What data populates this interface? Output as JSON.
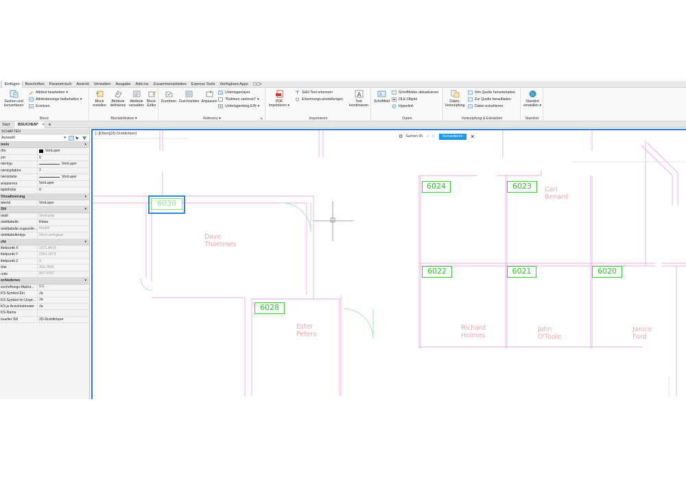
{
  "menu_tabs": [
    "Einfügen",
    "Beschriften",
    "Parametrisch",
    "Ansicht",
    "Verwalten",
    "Ausgabe",
    "Add-ins",
    "Zusammenarbeiten",
    "Express Tools",
    "Verfügbare Apps",
    "▢▢•"
  ],
  "ribbon": {
    "block_panel": {
      "title": "Block",
      "suchen_l1": "Suchen und",
      "suchen_l2": "konvertieren",
      "attr_bearbeiten": "Attribut bearbeiten",
      "attr_beibehalten": "Attributanzeige beibehalten",
      "ersetzen": "Ersetzen"
    },
    "blockdef_panel": {
      "title": "Blockdefinition",
      "block_l1": "Block",
      "block_l2": "erstellen",
      "attr_def_l1": "Attribute",
      "attr_def_l2": "definieren",
      "attr_verw_l1": "Attribute",
      "attr_verw_l2": "verwalten",
      "editor_l1": "Block-",
      "editor_l2": "Editor"
    },
    "referenz_panel": {
      "title": "Referenz",
      "zuordnen": "Zuordnen",
      "zuschneiden": "Zuschneiden",
      "anpassen": "Anpassen",
      "unterlagenlayer": "Unterlagenlayer",
      "rahmen": "*Rahmen variieren*",
      "unterlagenfang": "Unterlagenfang EIN"
    },
    "importieren_panel": {
      "title": "Importieren",
      "pdf_l1": "PDF",
      "pdf_l2": "importieren",
      "shx": "SHX-Text erkennen",
      "erkennung": "Erkennungs-einstellungen",
      "text_l1": "Text",
      "text_l2": "kombinieren"
    },
    "daten_panel": {
      "title": "Daten",
      "schriftfeld": "Schriftfeld",
      "schriftfelder_akt": "Schriftfelder aktualisieren",
      "ole": "OLE-Objekt",
      "hyperlink": "Hyperlink"
    },
    "verkn_panel": {
      "title": "Verknüpfung & Extraktion",
      "datenverkn_l1": "Daten-",
      "datenverkn_l2": "Verknüpfung",
      "herunterladen": "Von Quelle herunterladen",
      "heraufladen": "Zur Quelle heraufladen",
      "extrahieren": "Daten extrahieren"
    },
    "standort_panel": {
      "title": "Standort",
      "standort_l1": "Standort",
      "standort_l2": "einstellen"
    }
  },
  "file_tabs": {
    "start": "Start",
    "current": "BSUCHEN*",
    "close": "×",
    "add": "+"
  },
  "properties": {
    "header": "SCHAFTEN",
    "selection": "Auswahl",
    "sections": [
      {
        "title": "mein",
        "rows": [
          {
            "k": "rbe",
            "v": "VonLayer",
            "swatch": true
          },
          {
            "k": "yer",
            "v": "0"
          },
          {
            "k": "nientyp",
            "v": "VonLayer",
            "line": true
          },
          {
            "k": "nientypfaktor",
            "v": "1"
          },
          {
            "k": "nienstärke",
            "v": "VonLayer",
            "line": true
          },
          {
            "k": "ansparenz",
            "v": "VonLayer"
          },
          {
            "k": "bjekthöhe",
            "v": "0"
          }
        ]
      },
      {
        "title": "Visualisierung",
        "rows": [
          {
            "k": "aterial",
            "v": "VonLayer"
          }
        ]
      },
      {
        "title": "Stil",
        "rows": [
          {
            "k": "otstil",
            "v": "VonFarbe",
            "gray": true
          },
          {
            "k": "otstiltabelle",
            "v": "Keine"
          },
          {
            "k": "otstiltabelle zugeordn...",
            "v": "Modell",
            "gray": true
          },
          {
            "k": "otstiltabellentyp",
            "v": "Nicht verfügbar",
            "gray": true
          }
        ]
      },
      {
        "title": "cht",
        "rows": [
          {
            "k": "ittelpunkt X",
            "v": "1671.8419",
            "gray": true
          },
          {
            "k": "ittelpunkt Y",
            "v": "2561.2873",
            "gray": true
          },
          {
            "k": "ittelpunkt Z",
            "v": "0",
            "gray": true
          },
          {
            "k": "öhe",
            "v": "416.7602",
            "gray": true
          },
          {
            "k": "reite",
            "v": "807.9787",
            "gray": true
          }
        ]
      },
      {
        "title": "schiedenes",
        "rows": [
          {
            "k": "eschriftungs-Maßst...",
            "v": "1:1"
          },
          {
            "k": "KS-Symbol Ein",
            "v": "Ja"
          },
          {
            "k": "KS-Symbol im Urspr...",
            "v": "Ja"
          },
          {
            "k": "KS je Ansichtsfenster",
            "v": "Ja"
          },
          {
            "k": "KS-Name",
            "v": ""
          },
          {
            "k": "isueller Stil",
            "v": "2D-Drahtkörper"
          }
        ]
      }
    ]
  },
  "viewport": {
    "label": "[−][Oben][2D-Drahtkörper]",
    "search_label": "Suchen 99",
    "convert_button": "Konvertieren",
    "close": "✕",
    "room_tags": [
      "6030",
      "6024",
      "6023",
      "6022",
      "6021",
      "6020",
      "6028"
    ],
    "names": {
      "dave_1": "Dave",
      "dave_2": "Thommes",
      "carl_1": "Carl",
      "carl_2": "Benard",
      "ester_1": "Ester",
      "ester_2": "Peters",
      "richard_1": "Richard",
      "richard_2": "Holmes",
      "john_1": "John",
      "john_2": "O'Toole",
      "janice_1": "Janice",
      "janice_2": "Ford"
    }
  },
  "colors": {
    "accent": "#2b7ad9",
    "convert_button": "#2196e6",
    "room_tag": "#35c935",
    "name_text": "#f2a5a5",
    "walls": "#e3a3e3"
  }
}
